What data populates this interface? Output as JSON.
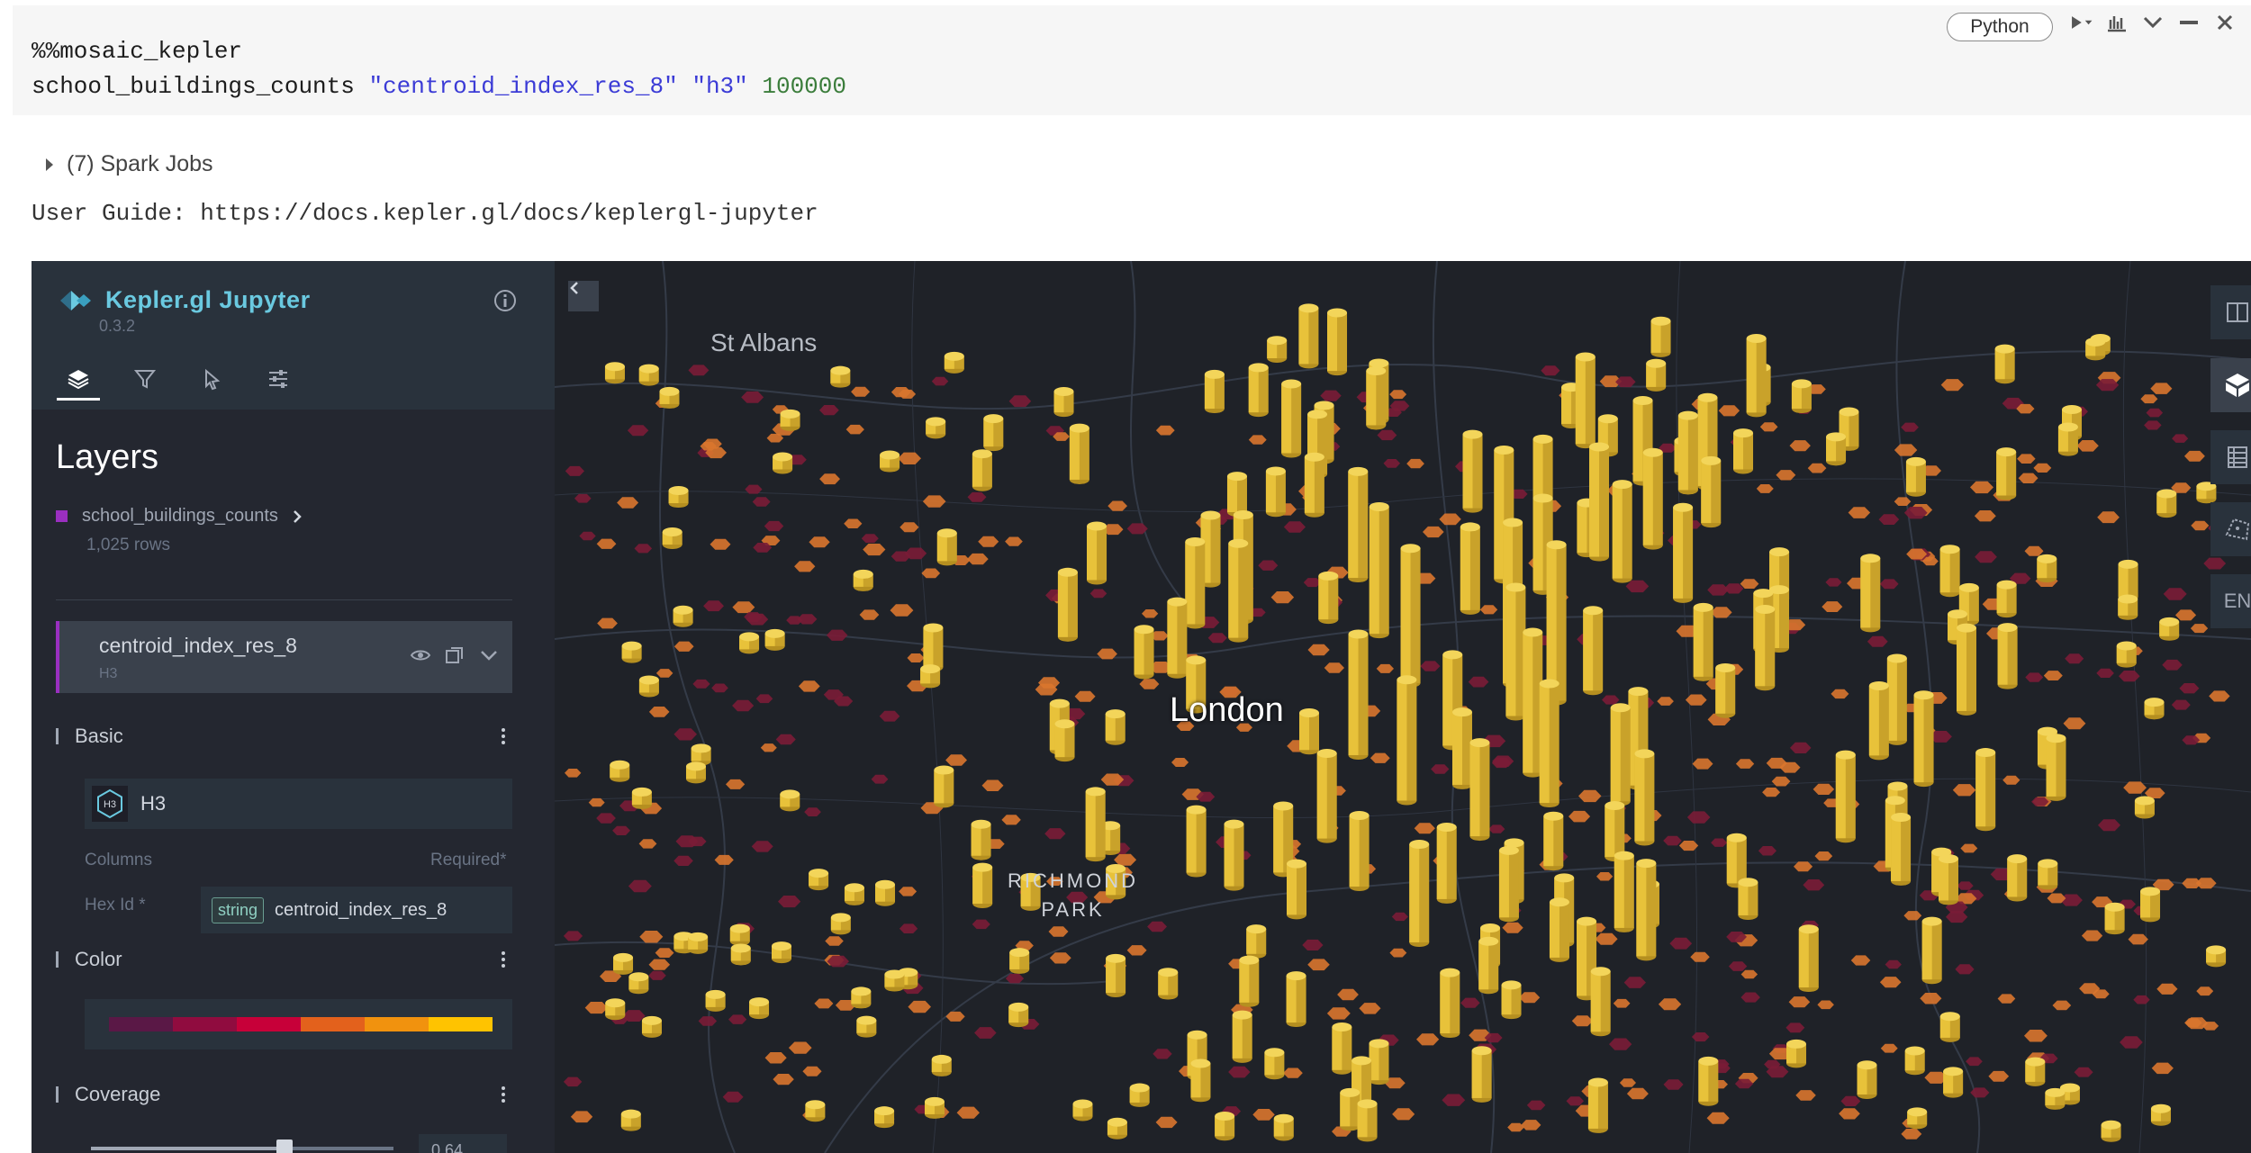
{
  "cell": {
    "magic": "%%mosaic_kepler",
    "code_table": "school_buildings_counts",
    "code_col": "\"centroid_index_res_8\"",
    "code_type": "\"h3\"",
    "code_limit": "100000",
    "language": "Python"
  },
  "output": {
    "spark_jobs": "(7) Spark Jobs",
    "user_guide": "User Guide: https://docs.kepler.gl/docs/keplergl-jupyter"
  },
  "sidebar": {
    "app_title": "Kepler.gl Jupyter",
    "version": "0.3.2",
    "tabs": [
      "layers-icon",
      "filter-icon",
      "interaction-icon",
      "settings-icon"
    ],
    "panel_title": "Layers",
    "dataset_name": "school_buildings_counts",
    "dataset_rows": "1,025 rows",
    "layer_name": "centroid_index_res_8",
    "layer_type": "H3",
    "sections": {
      "basic": "Basic",
      "color": "Color",
      "coverage": "Coverage"
    },
    "layer_type_label": "H3",
    "columns_label": "Columns",
    "required_label": "Required*",
    "hex_id_label": "Hex Id *",
    "field_type": "string",
    "field_name": "centroid_index_res_8",
    "palette": [
      "#5a1846",
      "#900c3f",
      "#c70039",
      "#e3611c",
      "#f1920e",
      "#ffc300"
    ],
    "coverage_value": "0.64",
    "coverage_fraction": 0.64
  },
  "map": {
    "places": {
      "st_albans": "St Albans",
      "london": "London",
      "richmond_1": "RICHMOND",
      "richmond_2": "PARK"
    },
    "controls": [
      "split-map-icon",
      "3d-view-icon",
      "data-table-icon",
      "draw-polygon-icon"
    ],
    "locale": "EN",
    "colors": {
      "bar": "#e8c23a",
      "hex_orange": "#d9752e",
      "hex_red": "#7a1c36"
    }
  }
}
